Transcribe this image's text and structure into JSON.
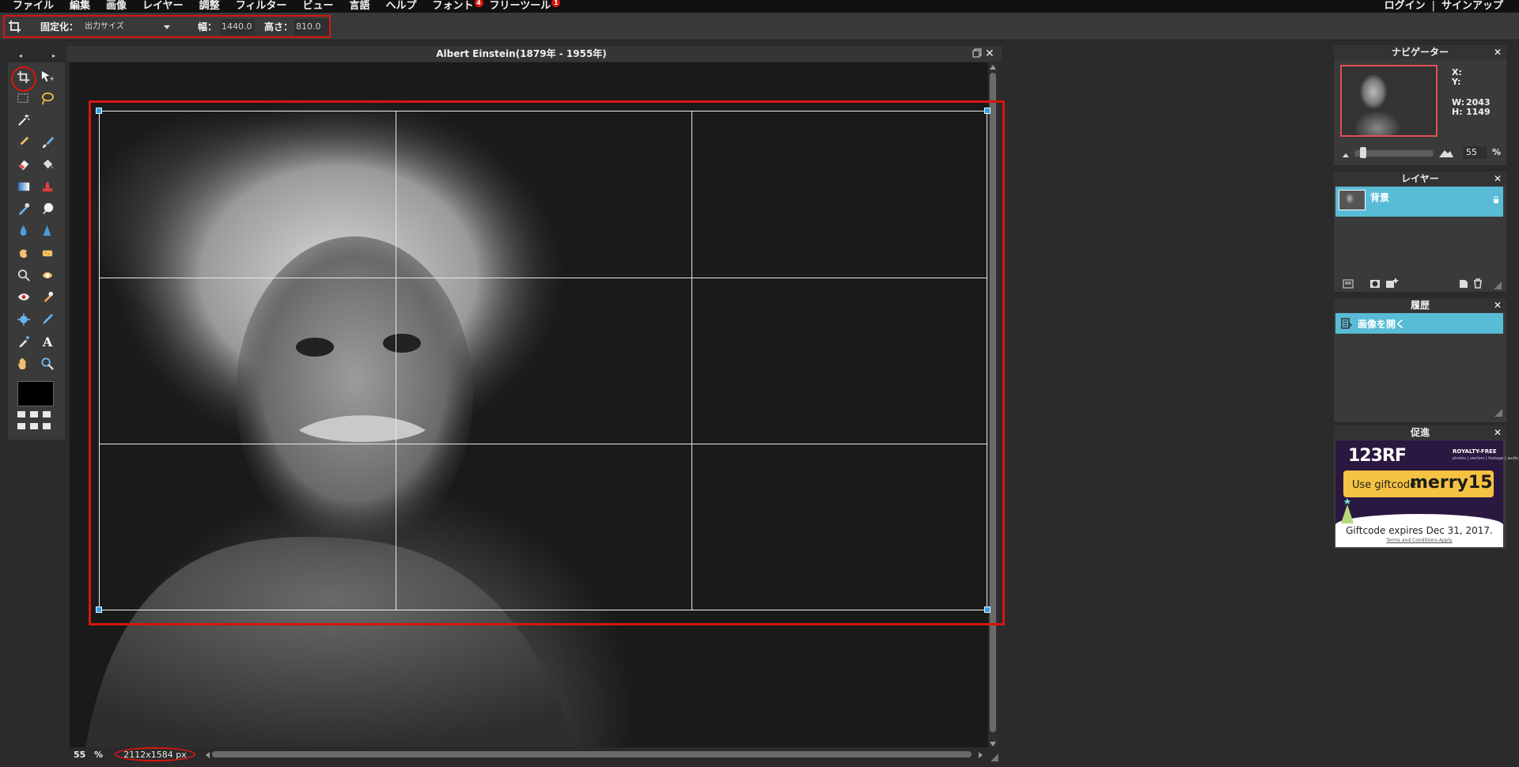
{
  "menu": {
    "items": [
      {
        "label": "ファイル"
      },
      {
        "label": "編集"
      },
      {
        "label": "画像"
      },
      {
        "label": "レイヤー"
      },
      {
        "label": "調整"
      },
      {
        "label": "フィルター"
      },
      {
        "label": "ビュー"
      },
      {
        "label": "言語"
      },
      {
        "label": "ヘルプ"
      },
      {
        "label": "フォント",
        "badge": "4"
      },
      {
        "label": "フリーツール",
        "badge": "1"
      }
    ],
    "login": "ログイン",
    "separator": "|",
    "signup": "サインアップ"
  },
  "options": {
    "fixed_label": "固定化：",
    "fixed_value": "出力サイズ",
    "width_label": "幅：",
    "width_value": "1440.0",
    "height_label": "高さ：",
    "height_value": "810.0"
  },
  "document": {
    "title": "Albert Einstein(1879年 - 1955年)",
    "zoom": "55",
    "zoom_unit": "%",
    "dimensions": "2112x1584 px"
  },
  "navigator": {
    "title": "ナビゲーター",
    "x_label": "X:",
    "y_label": "Y:",
    "w_label": "W:",
    "w_value": "2043",
    "h_label": "H:",
    "h_value": "1149",
    "zoom": "55",
    "zoom_unit": "%",
    "zoom_level": 0.08
  },
  "layers": {
    "title": "レイヤー",
    "items": [
      {
        "name": "背景",
        "locked": true
      }
    ]
  },
  "history": {
    "title": "履歴",
    "items": [
      {
        "label": "画像を開く"
      }
    ]
  },
  "promo": {
    "title": "促進",
    "logo": "123RF",
    "royalty": "ROYALTY-FREE",
    "sub": "photos | vectors | footage | audio",
    "use_giftcode": "Use giftcode:",
    "code": "merry15",
    "expires": "Giftcode expires Dec 31, 2017.",
    "terms": "Terms and Conditions Apply"
  },
  "colors": {
    "highlight": "#d8150f",
    "selection": "#59bcd6",
    "handle": "#3aa0e8",
    "foreground": "#000000"
  },
  "tools": [
    "crop-tool",
    "move-tool",
    "marquee-tool",
    "lasso-tool",
    "magic-wand-tool",
    "pencil-tool",
    "brush-tool",
    "eraser-tool",
    "paint-bucket-tool",
    "gradient-tool",
    "clone-stamp-tool",
    "color-replace-tool",
    "spot-heal-tool",
    "blur-tool",
    "sharpen-tool",
    "smudge-tool",
    "sponge-tool",
    "dodge-tool",
    "burn-tool",
    "red-eye-tool",
    "bloat-tool",
    "pinch-tool",
    "pen-tool",
    "eyedropper-tool",
    "type-tool",
    "hand-tool",
    "zoom-tool"
  ]
}
